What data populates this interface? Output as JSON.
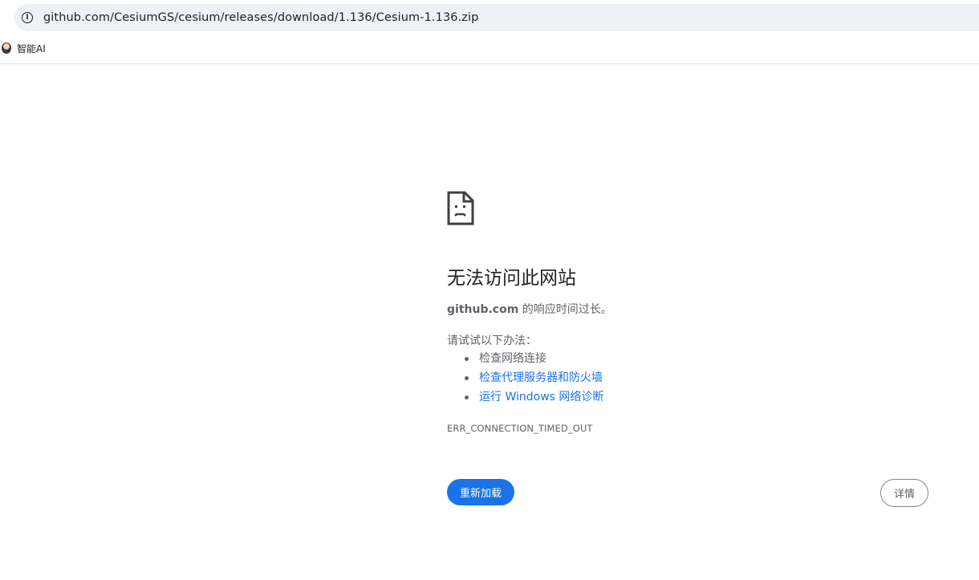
{
  "browser": {
    "url": "github.com/CesiumGS/cesium/releases/download/1.136/Cesium-1.136.zip",
    "bookmarks": [
      {
        "label": "智能AI"
      }
    ]
  },
  "error_page": {
    "title": "无法访问此网站",
    "host": "github.com",
    "description": " 的响应时间过长。",
    "try_label": "请试试以下办法：",
    "suggestions": [
      {
        "text": "检查网络连接",
        "link": false
      },
      {
        "text": "检查代理服务器和防火墙",
        "link": true
      },
      {
        "text": "运行 Windows 网络诊断",
        "link": true
      }
    ],
    "error_code": "ERR_CONNECTION_TIMED_OUT",
    "reload_label": "重新加载",
    "details_label": "详情"
  },
  "colors": {
    "accent": "#1a73e8",
    "text_secondary": "#5f6368",
    "omnibox_bg": "#eef1f6"
  }
}
